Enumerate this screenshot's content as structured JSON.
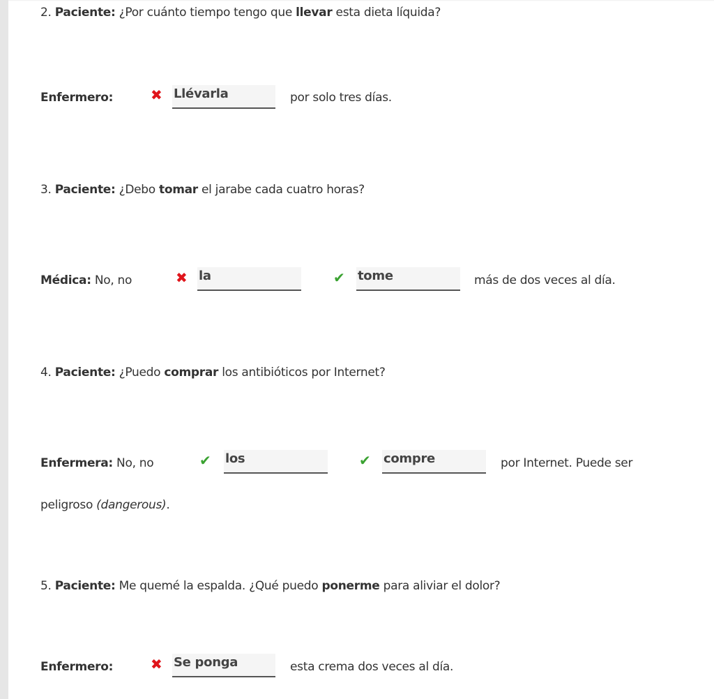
{
  "items": [
    {
      "number": "2.",
      "question_speaker": "Paciente:",
      "question_pre": "¿Por cuánto tiempo tengo que",
      "question_bold": "llevar",
      "question_post": "esta dieta líquida?",
      "answer_speaker": "Enfermero:",
      "answer_pre": "",
      "blanks": [
        {
          "value": "Llévarla",
          "status": "incorrect",
          "icon": "x-icon"
        }
      ],
      "answer_post": "por solo tres días."
    },
    {
      "number": "3.",
      "question_speaker": "Paciente:",
      "question_pre": "¿Debo",
      "question_bold": "tomar",
      "question_post": "el jarabe cada cuatro horas?",
      "answer_speaker": "Médica:",
      "answer_pre": "No, no",
      "blanks": [
        {
          "value": "la",
          "status": "incorrect",
          "icon": "x-icon"
        },
        {
          "value": "tome",
          "status": "correct",
          "icon": "check-icon"
        }
      ],
      "answer_post": "más de dos veces al día."
    },
    {
      "number": "4.",
      "question_speaker": "Paciente:",
      "question_pre": "¿Puedo",
      "question_bold": "comprar",
      "question_post": "los antibióticos por Internet?",
      "answer_speaker": "Enfermera:",
      "answer_pre": "No, no",
      "blanks": [
        {
          "value": "los",
          "status": "correct",
          "icon": "check-icon"
        },
        {
          "value": "compre",
          "status": "correct",
          "icon": "check-icon"
        }
      ],
      "answer_post": "por Internet. Puede ser",
      "answer_continuation": "peligroso",
      "answer_continuation_italic": "(dangerous)",
      "answer_continuation_end": "."
    },
    {
      "number": "5.",
      "question_speaker": "Paciente:",
      "question_pre": "Me quemé la espalda. ¿Qué puedo",
      "question_bold": "ponerme",
      "question_post": "para aliviar el dolor?",
      "answer_speaker": "Enfermero:",
      "answer_pre": "",
      "blanks": [
        {
          "value": "Se ponga",
          "status": "incorrect",
          "icon": "x-icon"
        }
      ],
      "answer_post": "esta crema dos veces al día."
    }
  ],
  "icons": {
    "incorrect": "✖",
    "correct": "✔"
  },
  "colors": {
    "incorrect": "#e0151b",
    "correct": "#3aa231"
  }
}
